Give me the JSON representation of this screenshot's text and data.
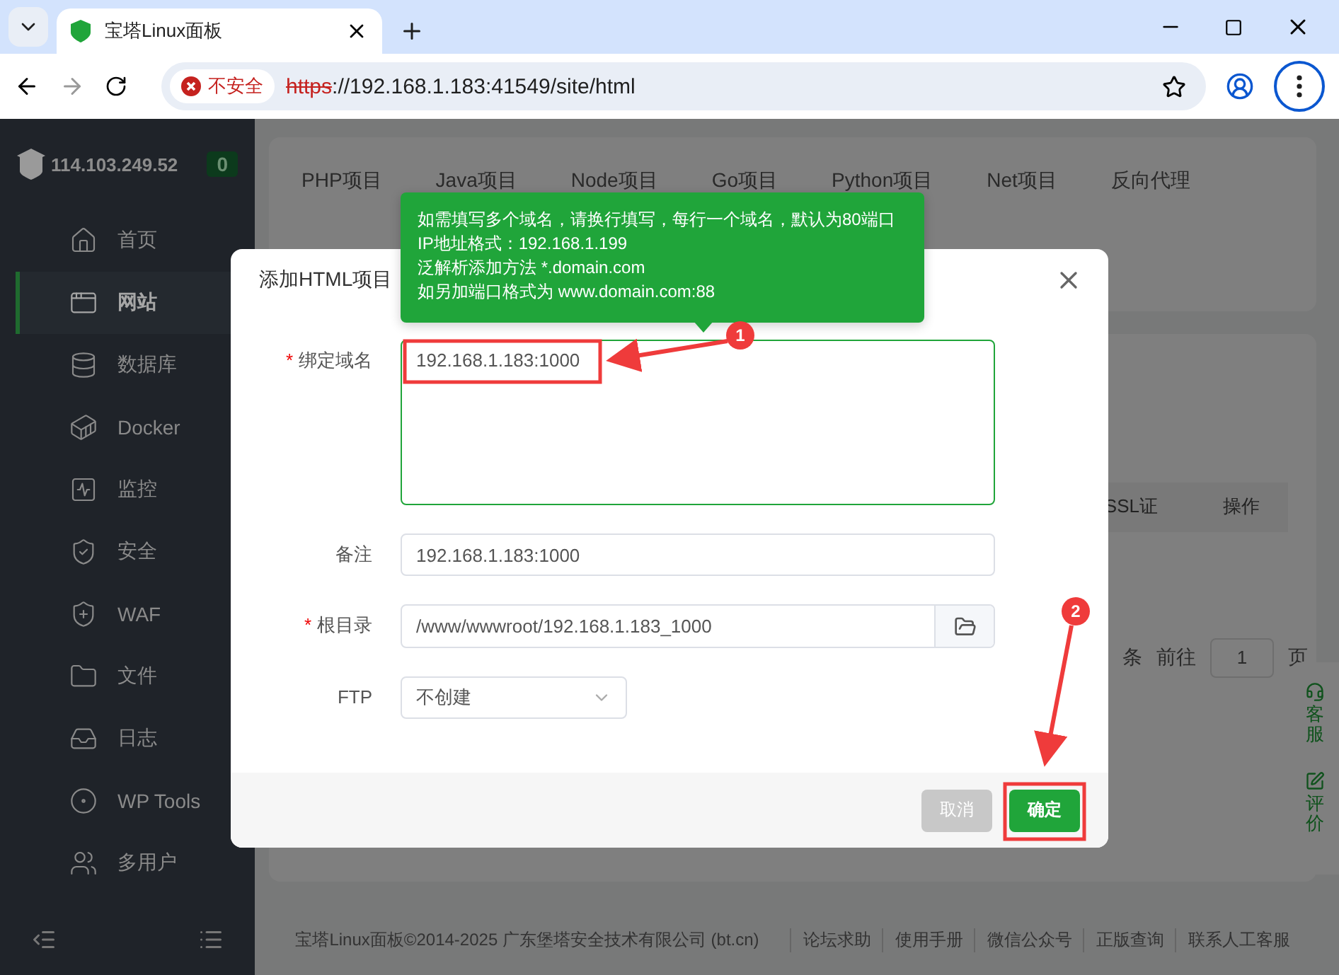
{
  "browser": {
    "tab_title": "宝塔Linux面板",
    "security_label": "不安全",
    "url": {
      "scheme": "https",
      "rest": "://192.168.1.183:41549/site/html"
    }
  },
  "sidebar": {
    "server_ip": "114.103.249.52",
    "badge": "0",
    "items": [
      {
        "label": "首页",
        "selected": false
      },
      {
        "label": "网站",
        "selected": true
      },
      {
        "label": "数据库",
        "selected": false
      },
      {
        "label": "Docker",
        "selected": false
      },
      {
        "label": "监控",
        "selected": false
      },
      {
        "label": "安全",
        "selected": false
      },
      {
        "label": "WAF",
        "selected": false
      },
      {
        "label": "文件",
        "selected": false
      },
      {
        "label": "日志",
        "selected": false
      },
      {
        "label": "WP Tools",
        "selected": false
      },
      {
        "label": "多用户",
        "selected": false
      }
    ]
  },
  "project_tabs": [
    "PHP项目",
    "Java项目",
    "Node项目",
    "Go项目",
    "Python项目",
    "Net项目",
    "反向代理"
  ],
  "table": {
    "columns": [
      "SSL证",
      "操作"
    ]
  },
  "pagination": {
    "suffix": "条",
    "goto_label": "前往",
    "page": "1",
    "page_unit": "页"
  },
  "side_widget": [
    "客服",
    "评价"
  ],
  "footer": {
    "copyright": "宝塔Linux面板©2014-2025 广东堡塔安全技术有限公司 (bt.cn)",
    "links": [
      "论坛求助",
      "使用手册",
      "微信公众号",
      "正版查询",
      "联系人工客服"
    ]
  },
  "dialog": {
    "title": "添加HTML项目",
    "fields": [
      {
        "kind": "textarea",
        "label": "绑定域名",
        "required_mark": "*",
        "value": "192.168.1.183:1000",
        "focused": true
      },
      {
        "kind": "text",
        "label": "备注",
        "value": "192.168.1.183:1000",
        "focused": false
      },
      {
        "kind": "path",
        "label": "根目录",
        "required_mark": "*",
        "value": "/www/wwwroot/192.168.1.183_1000",
        "focused": false
      },
      {
        "kind": "select",
        "label": "FTP",
        "value": "不创建",
        "focused": false
      }
    ],
    "buttons": [
      {
        "kind": "cancel",
        "label": "取消"
      },
      {
        "kind": "primary",
        "label": "确定"
      }
    ]
  },
  "tooltip": {
    "lines": [
      "如需填写多个域名，请换行填写，每行一个域名，默认为80端口",
      "IP地址格式：192.168.1.199",
      "泛解析添加方法 *.domain.com",
      "如另加端口格式为 www.domain.com:88"
    ]
  },
  "annotations": [
    "1",
    "2"
  ]
}
